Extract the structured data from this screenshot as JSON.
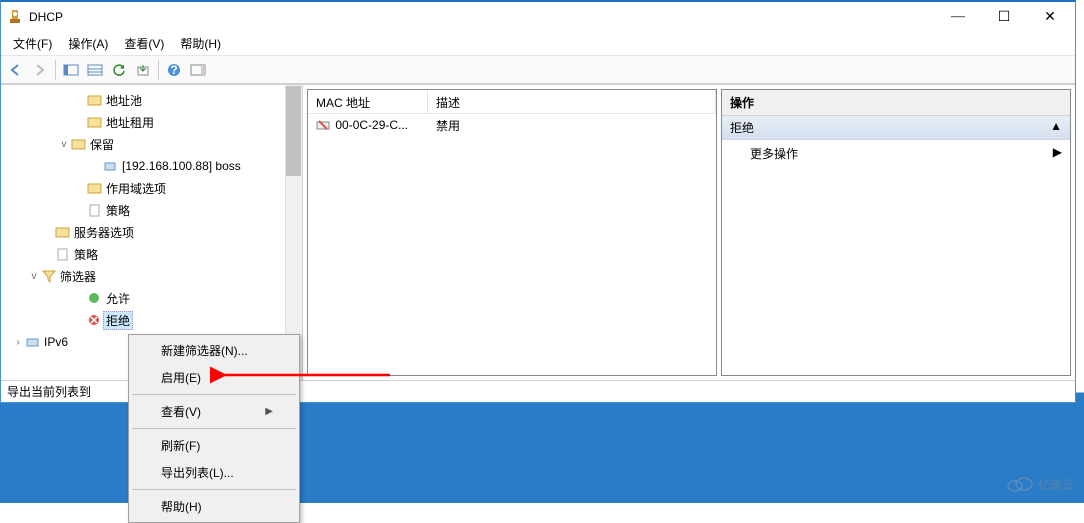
{
  "window": {
    "title": "DHCP",
    "controls": {
      "min": "—",
      "max": "☐",
      "close": "✕"
    }
  },
  "menubar": {
    "file": "文件(F)",
    "action": "操作(A)",
    "view": "查看(V)",
    "help": "帮助(H)"
  },
  "tree": {
    "items": {
      "addr_pool": "地址池",
      "lease": "地址租用",
      "reserve": "保留",
      "reserve_item": "[192.168.100.88] boss",
      "scope_opts": "作用域选项",
      "policy1": "策略",
      "server_opts": "服务器选项",
      "policy2": "策略",
      "filters": "筛选器",
      "allow": "允许",
      "deny": "拒绝",
      "ipv6": "IPv6"
    }
  },
  "list": {
    "headers": {
      "mac": "MAC 地址",
      "desc": "描述"
    },
    "rows": [
      {
        "mac": "00-0C-29-C...",
        "desc": "禁用"
      }
    ]
  },
  "actions": {
    "title": "操作",
    "section": "拒绝",
    "more": "更多操作"
  },
  "statusbar": {
    "text": "导出当前列表到"
  },
  "context_menu": {
    "new_filter": "新建筛选器(N)...",
    "enable": "启用(E)",
    "view": "查看(V)",
    "refresh": "刷新(F)",
    "export": "导出列表(L)...",
    "help": "帮助(H)"
  },
  "watermark": {
    "text": "亿速云"
  }
}
